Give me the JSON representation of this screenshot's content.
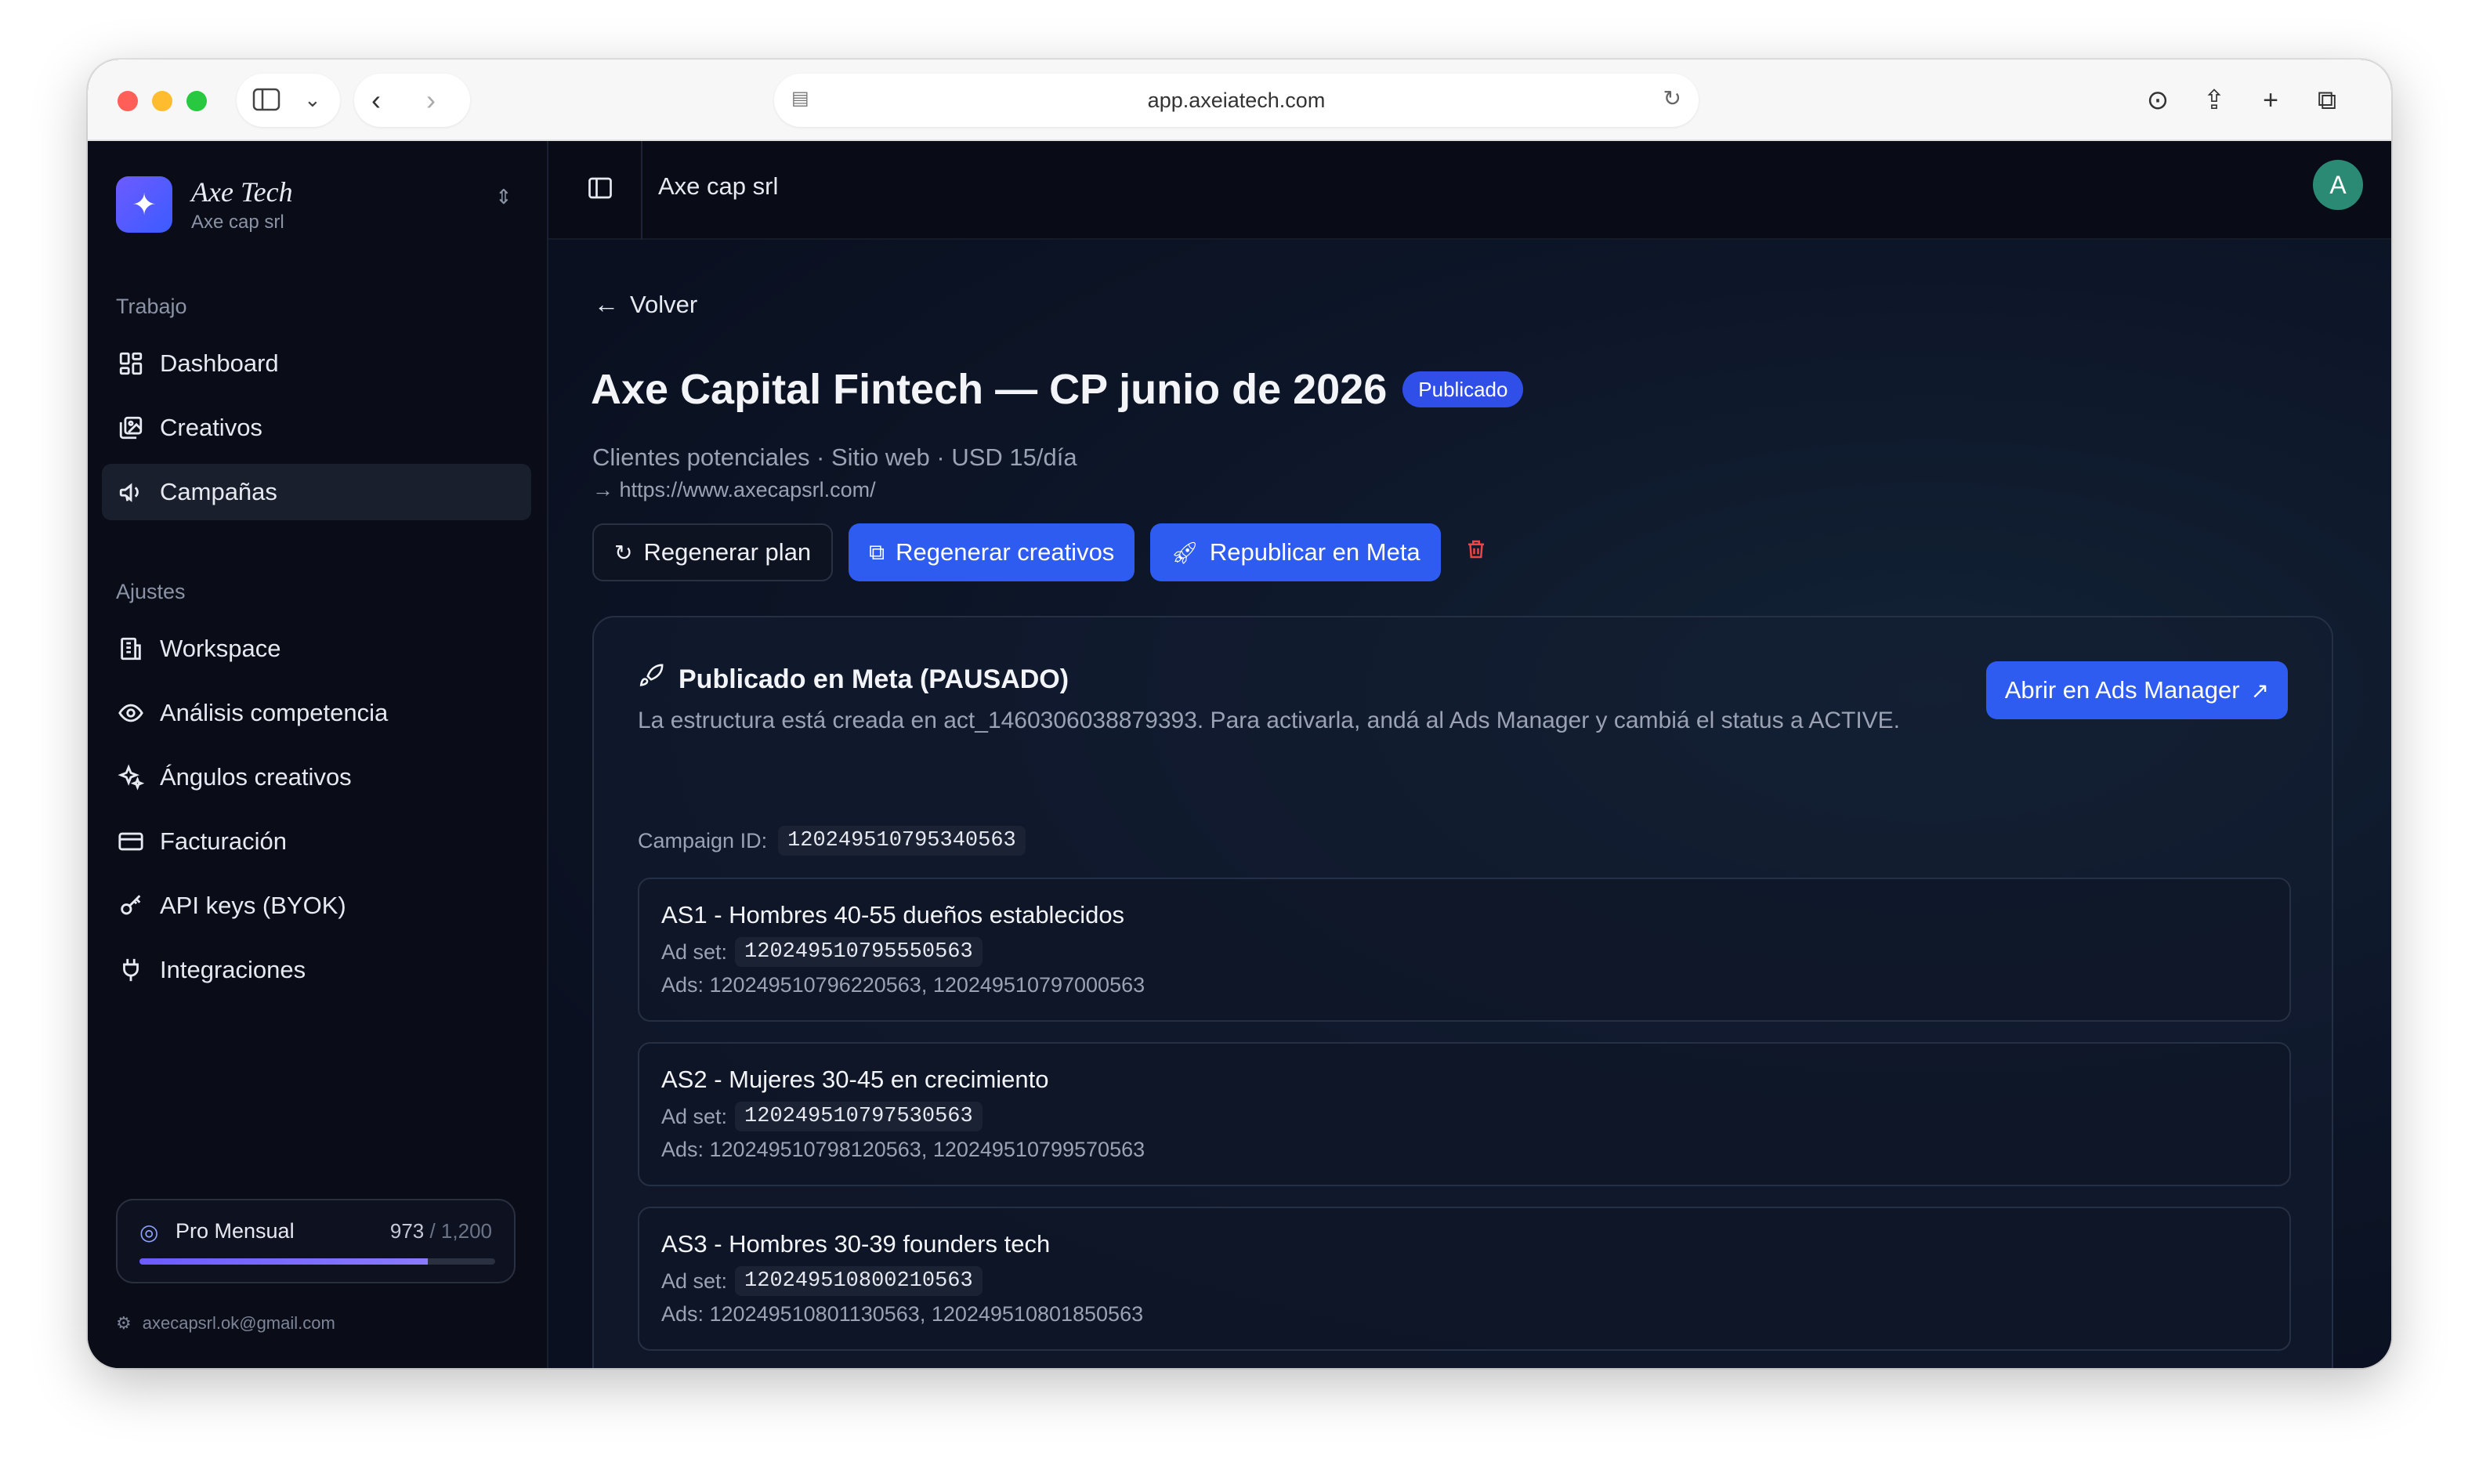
{
  "browser": {
    "url": "app.axeiatech.com"
  },
  "sidebar": {
    "brand_name": "Axe Tech",
    "brand_sub": "Axe cap srl",
    "section_work": "Trabajo",
    "work_items": [
      {
        "label": "Dashboard",
        "icon": "dashboard-icon"
      },
      {
        "label": "Creativos",
        "icon": "images-icon"
      },
      {
        "label": "Campañas",
        "icon": "megaphone-icon"
      }
    ],
    "section_settings": "Ajustes",
    "settings_items": [
      {
        "label": "Workspace",
        "icon": "building-icon"
      },
      {
        "label": "Análisis competencia",
        "icon": "eye-icon"
      },
      {
        "label": "Ángulos creativos",
        "icon": "sparkles-icon"
      },
      {
        "label": "Facturación",
        "icon": "credit-card-icon"
      },
      {
        "label": "API keys (BYOK)",
        "icon": "key-icon"
      },
      {
        "label": "Integraciones",
        "icon": "plug-icon"
      }
    ],
    "plan": {
      "name": "Pro Mensual",
      "used": "973",
      "total": "/ 1,200",
      "fraction": 0.81
    },
    "account_email": "axecapsrl.ok@gmail.com"
  },
  "topbar": {
    "title": "Axe cap srl",
    "avatar_initial": "A"
  },
  "main": {
    "back_label": "Volver",
    "title": "Axe Capital Fintech — CP junio de 2026",
    "status_badge": "Publicado",
    "subtitle": "Clientes potenciales · Sitio web · USD 15/día",
    "url": "→ https://www.axecapsrl.com/",
    "buttons": {
      "regen_plan": "Regenerar plan",
      "regen_creatives": "Regenerar creativos",
      "republish": "Republicar en Meta"
    }
  },
  "meta_card": {
    "title": "Publicado en Meta (PAUSADO)",
    "description": "La estructura está creada en act_1460306038879393. Para activarla, andá al Ads Manager y cambiá el status a ACTIVE.",
    "open_button": "Abrir en Ads Manager",
    "campaign_label": "Campaign ID:",
    "campaign_id": "120249510795340563",
    "adset_label": "Ad set:",
    "adsets": [
      {
        "name": "AS1 - Hombres 40-55 dueños establecidos",
        "adset_id": "120249510795550563",
        "ads": "Ads: 120249510796220563, 120249510797000563"
      },
      {
        "name": "AS2 - Mujeres 30-45 en crecimiento",
        "adset_id": "120249510797530563",
        "ads": "Ads: 120249510798120563, 120249510799570563"
      },
      {
        "name": "AS3 - Hombres 30-39 founders tech",
        "adset_id": "120249510800210563",
        "ads": "Ads: 120249510801130563, 120249510801850563"
      }
    ]
  },
  "colors": {
    "accent": "#2f5cf0",
    "badge": "#2f4fe8",
    "danger": "#ef4444",
    "avatar": "#2a8a74"
  }
}
